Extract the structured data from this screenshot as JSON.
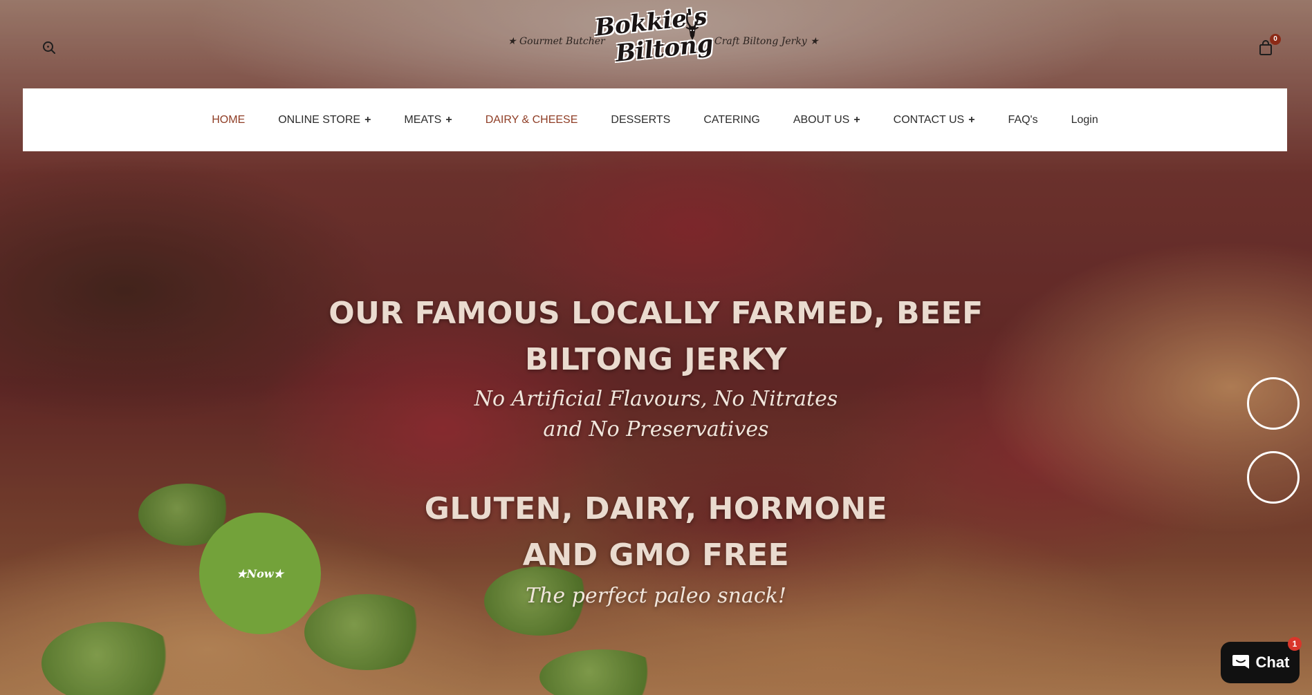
{
  "header": {
    "tagline_left": "★ Gourmet Butcher",
    "tagline_right": "Craft Biltong Jerky ★",
    "logo_line1": "Bokkie's",
    "logo_line2": "Biltong",
    "cart_count": "0"
  },
  "nav": {
    "items": [
      {
        "label": "HOME",
        "has_submenu": false
      },
      {
        "label": "ONLINE STORE",
        "has_submenu": true
      },
      {
        "label": "MEATS",
        "has_submenu": true
      },
      {
        "label": "DAIRY & CHEESE",
        "has_submenu": false
      },
      {
        "label": "DESSERTS",
        "has_submenu": false
      },
      {
        "label": "CATERING",
        "has_submenu": false
      },
      {
        "label": "ABOUT US",
        "has_submenu": true
      },
      {
        "label": "CONTACT US",
        "has_submenu": true
      },
      {
        "label": "FAQ's",
        "has_submenu": false
      },
      {
        "label": "Login",
        "has_submenu": false
      }
    ],
    "plus_symbol": "+"
  },
  "hero": {
    "headline1_line1": "OUR FAMOUS LOCALLY FARMED, BEEF",
    "headline1_line2": "BILTONG JERKY",
    "subline1": "No Artificial Flavours, No Nitrates and No Preservatives",
    "headline2_line1": "GLUTEN, DAIRY, HORMONE",
    "headline2_line2": "AND GMO FREE",
    "subline2": "The perfect paleo snack!"
  },
  "badge": {
    "label": "★Now★"
  },
  "chat": {
    "label": "Chat",
    "unread": "1"
  },
  "colors": {
    "nav_accent": "#8f3d25",
    "badge_green": "#73a23a",
    "cart_badge": "#8c2a16",
    "chat_bg": "#111111",
    "chat_badge": "#d9362b"
  },
  "icons": {
    "search": "search-icon",
    "cart": "shopping-bag-icon",
    "chat": "chat-bubble-icon",
    "logo_mark": "antelope-icon"
  }
}
